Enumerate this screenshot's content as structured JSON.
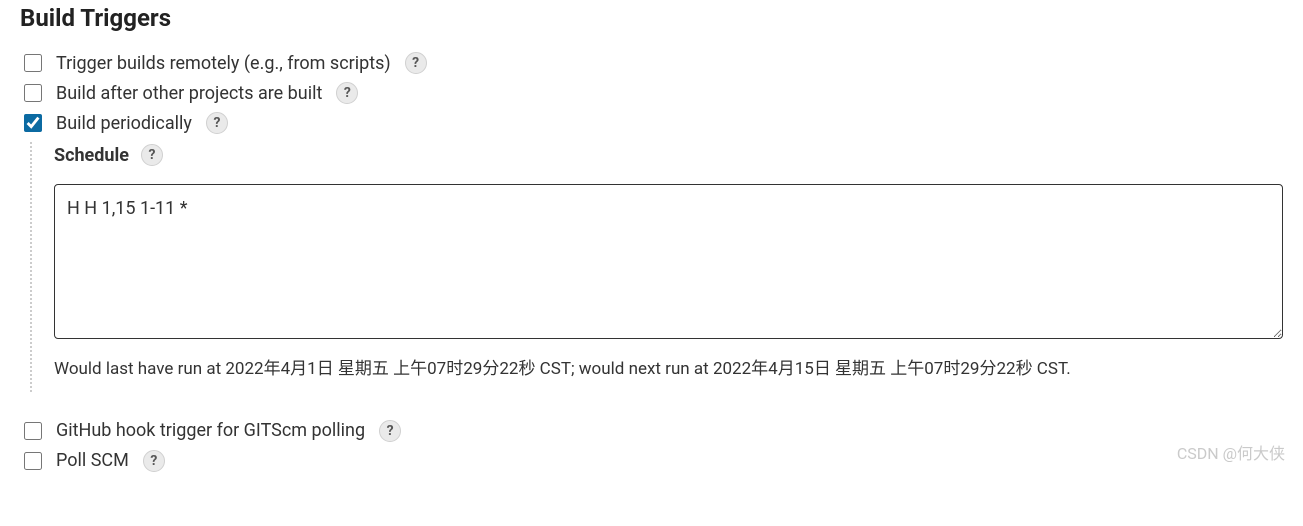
{
  "section": {
    "title": "Build Triggers"
  },
  "triggers": {
    "remote": {
      "label": "Trigger builds remotely (e.g., from scripts)",
      "checked": false
    },
    "after": {
      "label": "Build after other projects are built",
      "checked": false
    },
    "periodic": {
      "label": "Build periodically",
      "checked": true
    },
    "github": {
      "label": "GitHub hook trigger for GITScm polling",
      "checked": false
    },
    "pollscm": {
      "label": "Poll SCM",
      "checked": false
    }
  },
  "schedule": {
    "label": "Schedule",
    "value": "H H 1,15 1-11 *",
    "hint": "Would last have run at 2022年4月1日 星期五 上午07时29分22秒 CST; would next run at 2022年4月15日 星期五 上午07时29分22秒 CST."
  },
  "help": {
    "symbol": "?"
  },
  "watermark": "CSDN @何大侠"
}
